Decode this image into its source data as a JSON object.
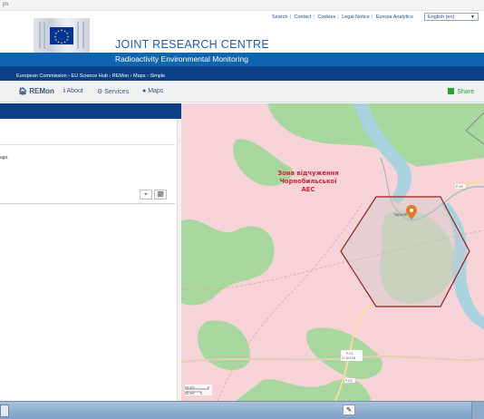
{
  "browser": {
    "url_fragment": "ps"
  },
  "utility_links": [
    "Search",
    "Contact",
    "Cookies",
    "Legal Notice",
    "Europa Analytics"
  ],
  "language": "English (en)",
  "logo": {
    "line1": "European",
    "line2": "Commission"
  },
  "site_title": "JOINT RESEARCH CENTRE",
  "site_subtitle": "Radioactivity Environmental Monitoring",
  "breadcrumb": "European Commission › EU Science Hub › REMon › Maps › Simple",
  "nav": {
    "brand": "REMon",
    "items": [
      "About",
      "Services",
      "Maps"
    ],
    "share": "Share"
  },
  "left_panel": {
    "text_fragment": "ago."
  },
  "map": {
    "zone_label": [
      "Зона відчуження",
      "Чорнобильської",
      "АЕС"
    ],
    "marker_label": "Чорноб",
    "road_labels": [
      "P-56",
      "P-02",
      "О-10116",
      "P-02"
    ],
    "scale": [
      "3 km",
      "2 mi"
    ],
    "colors": {
      "forest": "#a8d8a0",
      "zone": "#f6d3d6",
      "water": "#aad3df",
      "hexagon": "#9b1c1c",
      "marker": "#e07a2c"
    }
  },
  "taskbar": {}
}
